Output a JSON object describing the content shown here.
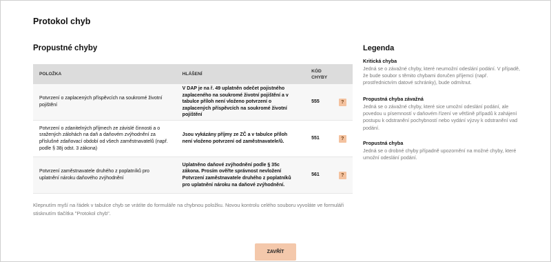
{
  "page": {
    "title": "Protokol chyb"
  },
  "section": {
    "title": "Propustné chyby"
  },
  "table": {
    "headers": {
      "item": "POLOŽKA",
      "message": "HLÁŠENÍ",
      "code": "KÓD CHYBY"
    },
    "rows": [
      {
        "item": "Potvrzení o zaplacených příspěvcích na soukromé životní pojištění",
        "message": "V DAP je na ř. 49 uplatněn odečet pojistného zaplaceného na soukromé životní pojištění a v tabulce příloh není vloženo potvrzení o zaplacených příspěvcích na soukromé životní pojištění",
        "code": "555",
        "help": "?"
      },
      {
        "item": "Potvrzení o zdanitelných příjmech ze závislé činnosti a o sražených zálohách na daň a daňovém zvýhodnění za příslušné zdaňovací období od všech zaměstnavatelů (např. podle § 38j odst. 3 zákona)",
        "message": "Jsou vykázány příjmy ze ZČ a v tabulce příloh není vloženo potvrzení od zaměstnavatele/ů.",
        "code": "551",
        "help": "?"
      },
      {
        "item": "Potvrzení zaměstnavatele druhého z poplatníků pro uplatnění nároku daňového zvýhodnění",
        "message": "Uplatněno daňové zvýhodnění podle § 35c zákona. Prosím ověřte správnost nevložení Potvrzení zaměstnavatele druhého z poplatníků pro uplatnění nároku na daňové zvýhodnění.",
        "code": "561",
        "help": "?"
      }
    ]
  },
  "note": "Klepnutím myší na řádek v tabulce chyb se vrátíte do formuláře na chybnou položku. Novou kontrolu celého souboru vyvoláte ve formuláři stisknutím tlačítka \"Protokol chyb\".",
  "close_label": "ZAVŘÍT",
  "legend": {
    "title": "Legenda",
    "items": [
      {
        "name": "Kritická chyba",
        "desc": "Jedná se o závažné chyby, které neumožní odeslání podání. V případě, že bude soubor s těmito chybami doručen příjemci (např. prostřednictvím datové schránky), bude odmítnut."
      },
      {
        "name": "Propustná chyba závažná",
        "desc": "Jedná se o závažné chyby, které sice umožní odeslání podání, ale povedou u písemností v daňovém řízení ve většině případů k zahájení postupu k odstranění pochybností nebo vydání výzvy k odstranění vad podání."
      },
      {
        "name": "Propustná chyba",
        "desc": "Jedná se o drobné chyby případně upozornění na možné chyby, které umožní odeslání podání."
      }
    ]
  },
  "colors": {
    "header_bg": "#dcdcdc",
    "badge_bg": "#f4c29f",
    "button_bg": "#f4c8ab"
  }
}
